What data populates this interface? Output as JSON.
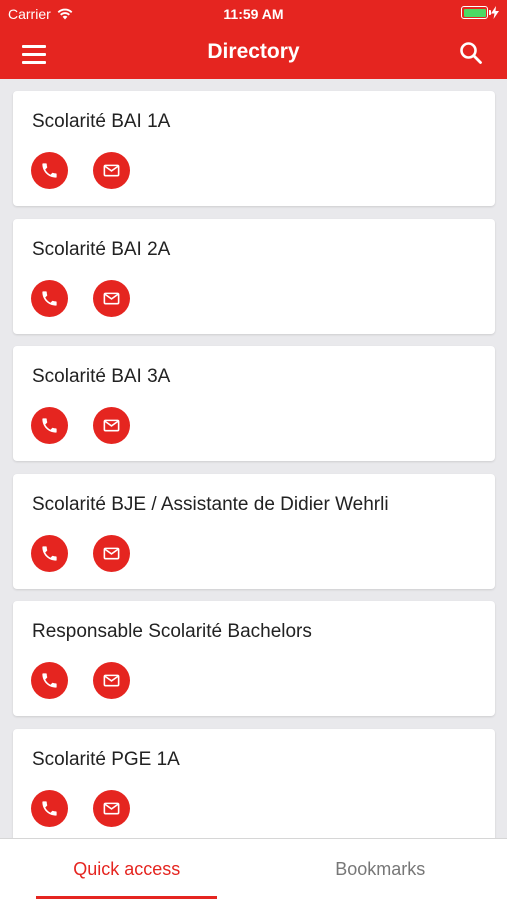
{
  "status_bar": {
    "carrier": "Carrier",
    "time": "11:59 AM",
    "battery_color": "#4cd964"
  },
  "header": {
    "title": "Directory",
    "menu_icon": "hamburger-menu-icon",
    "search_icon": "search-icon",
    "background": "#e52520"
  },
  "contacts": [
    {
      "name": "Scolarité BAI 1A"
    },
    {
      "name": "Scolarité BAI 2A"
    },
    {
      "name": "Scolarité BAI 3A"
    },
    {
      "name": "Scolarité BJE / Assistante de Didier Wehrli"
    },
    {
      "name": "Responsable Scolarité Bachelors"
    },
    {
      "name": "Scolarité PGE 1A"
    }
  ],
  "contact_actions": {
    "phone_icon": "phone-icon",
    "mail_icon": "mail-icon"
  },
  "tabs": [
    {
      "label": "Quick access",
      "active": true
    },
    {
      "label": "Bookmarks",
      "active": false
    }
  ]
}
